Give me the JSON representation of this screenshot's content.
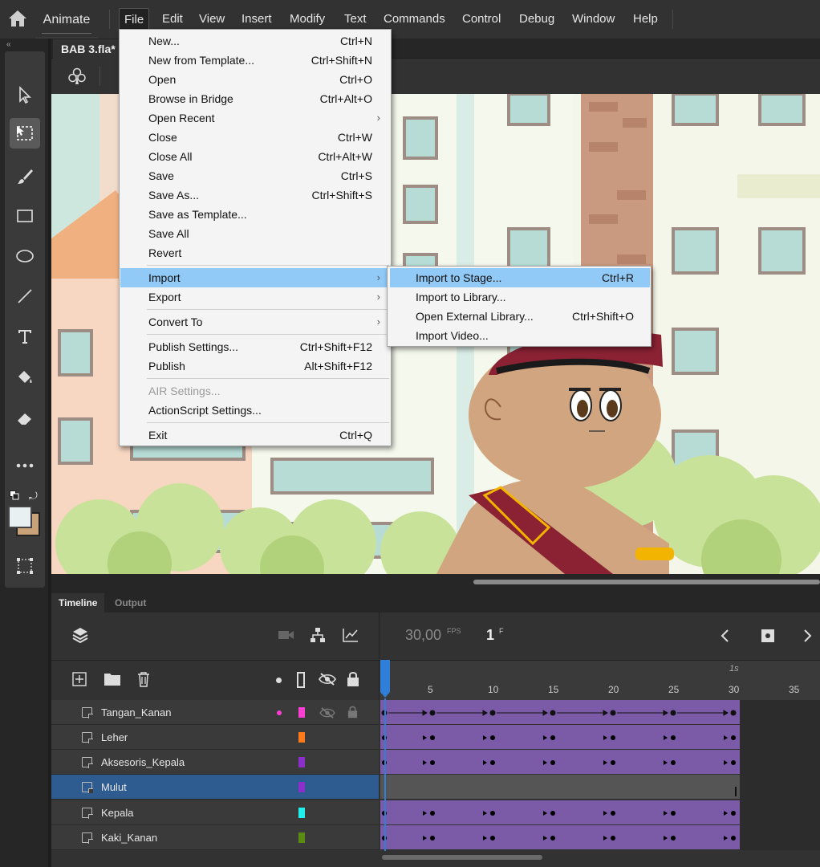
{
  "app": {
    "name": "Animate"
  },
  "menubar": {
    "items": [
      "File",
      "Edit",
      "View",
      "Insert",
      "Modify",
      "Text",
      "Commands",
      "Control",
      "Debug",
      "Window",
      "Help"
    ],
    "active": "File"
  },
  "document": {
    "tab_title": "BAB 3.fla*"
  },
  "file_menu": {
    "items": [
      {
        "label": "New...",
        "shortcut": "Ctrl+N"
      },
      {
        "label": "New from Template...",
        "shortcut": "Ctrl+Shift+N"
      },
      {
        "label": "Open",
        "shortcut": "Ctrl+O"
      },
      {
        "label": "Browse in Bridge",
        "shortcut": "Ctrl+Alt+O"
      },
      {
        "label": "Open Recent",
        "shortcut": ""
      },
      {
        "label": "Close",
        "shortcut": "Ctrl+W"
      },
      {
        "label": "Close All",
        "shortcut": "Ctrl+Alt+W"
      },
      {
        "label": "Save",
        "shortcut": "Ctrl+S"
      },
      {
        "label": "Save As...",
        "shortcut": "Ctrl+Shift+S"
      },
      {
        "label": "Save as Template...",
        "shortcut": ""
      },
      {
        "label": "Save All",
        "shortcut": ""
      },
      {
        "label": "Revert",
        "shortcut": ""
      },
      {
        "label": "Import",
        "shortcut": ""
      },
      {
        "label": "Export",
        "shortcut": ""
      },
      {
        "label": "Convert To",
        "shortcut": ""
      },
      {
        "label": "Publish Settings...",
        "shortcut": "Ctrl+Shift+F12"
      },
      {
        "label": "Publish",
        "shortcut": "Alt+Shift+F12"
      },
      {
        "label": "AIR Settings...",
        "shortcut": ""
      },
      {
        "label": "ActionScript Settings...",
        "shortcut": ""
      },
      {
        "label": "Exit",
        "shortcut": "Ctrl+Q"
      }
    ],
    "submenu_arrow": "›"
  },
  "import_submenu": {
    "items": [
      {
        "label": "Import to Stage...",
        "shortcut": "Ctrl+R"
      },
      {
        "label": "Import to Library...",
        "shortcut": ""
      },
      {
        "label": "Open External Library...",
        "shortcut": "Ctrl+Shift+O"
      },
      {
        "label": "Import Video...",
        "shortcut": ""
      }
    ]
  },
  "timeline": {
    "tabs": [
      "Timeline",
      "Output"
    ],
    "fps": "30,00",
    "fps_unit": "FPS",
    "current_frame": "1",
    "frame_unit": "F",
    "ruler_marks": [
      "5",
      "10",
      "15",
      "20",
      "25",
      "30",
      "35"
    ],
    "second_marker": "1s",
    "layers": [
      {
        "name": "Tangan_Kanan",
        "color": "#ff3fd2",
        "selected": false
      },
      {
        "name": "Leher",
        "color": "#ff7a1a",
        "selected": false
      },
      {
        "name": "Aksesoris_Kepala",
        "color": "#8a2fc9",
        "selected": false
      },
      {
        "name": "Mulut",
        "color": "#8a2fc9",
        "selected": true
      },
      {
        "name": "Kepala",
        "color": "#1ff0ee",
        "selected": false
      },
      {
        "name": "Kaki_Kanan",
        "color": "#5a8a12",
        "selected": false
      }
    ]
  },
  "colors": {
    "menu_highlight": "#91c9f7",
    "layer_selected": "#2e5c91",
    "frames": "#7b5aa8",
    "playhead": "#2f7fd8"
  }
}
